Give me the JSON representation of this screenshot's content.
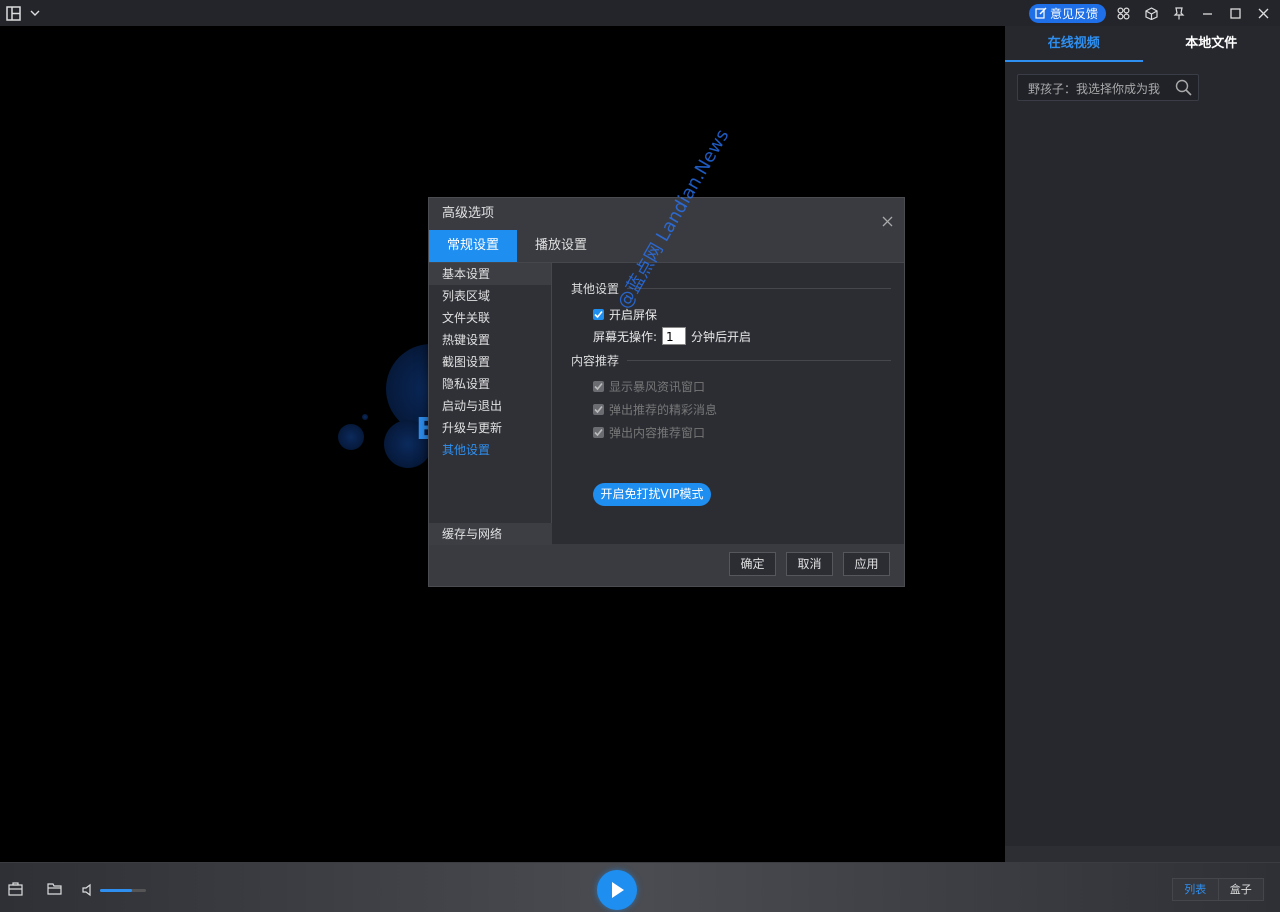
{
  "titlebar": {
    "feedback_label": "意见反馈",
    "icons": [
      "layout-icon",
      "chevron-down-icon",
      "apps-icon",
      "cube-icon",
      "pin-icon",
      "minimize-icon",
      "maximize-icon",
      "close-icon"
    ]
  },
  "sidebar": {
    "tabs": [
      {
        "label": "在线视频",
        "active": true
      },
      {
        "label": "本地文件",
        "active": false
      }
    ],
    "search": {
      "value": "野孩子：我选择你成为我"
    }
  },
  "dialog": {
    "title": "高级选项",
    "tabs": [
      {
        "label": "常规设置",
        "active": true
      },
      {
        "label": "播放设置",
        "active": false
      }
    ],
    "nav": [
      {
        "label": "基本设置"
      },
      {
        "label": "列表区域"
      },
      {
        "label": "文件关联"
      },
      {
        "label": "热键设置"
      },
      {
        "label": "截图设置"
      },
      {
        "label": "隐私设置"
      },
      {
        "label": "启动与退出"
      },
      {
        "label": "升级与更新"
      },
      {
        "label": "其他设置"
      }
    ],
    "nav_bottom": "缓存与网络",
    "content": {
      "section1": "其他设置",
      "screensaver_label": "开启屏保",
      "idle_prefix": "屏幕无操作:",
      "idle_minutes": "1",
      "idle_suffix": "分钟后开启",
      "section2": "内容推荐",
      "rec1": "显示暴风资讯窗口",
      "rec2": "弹出推荐的精彩消息",
      "rec3": "弹出内容推荐窗口",
      "vip_button": "开启免打扰VIP模式"
    },
    "buttons": {
      "ok": "确定",
      "cancel": "取消",
      "apply": "应用"
    }
  },
  "bottombar": {
    "volume_level": 0.7,
    "view_list": "列表",
    "view_box": "盒子"
  },
  "watermark": "@蓝点网 Landian.News",
  "accent_color": "#1f8ef1"
}
